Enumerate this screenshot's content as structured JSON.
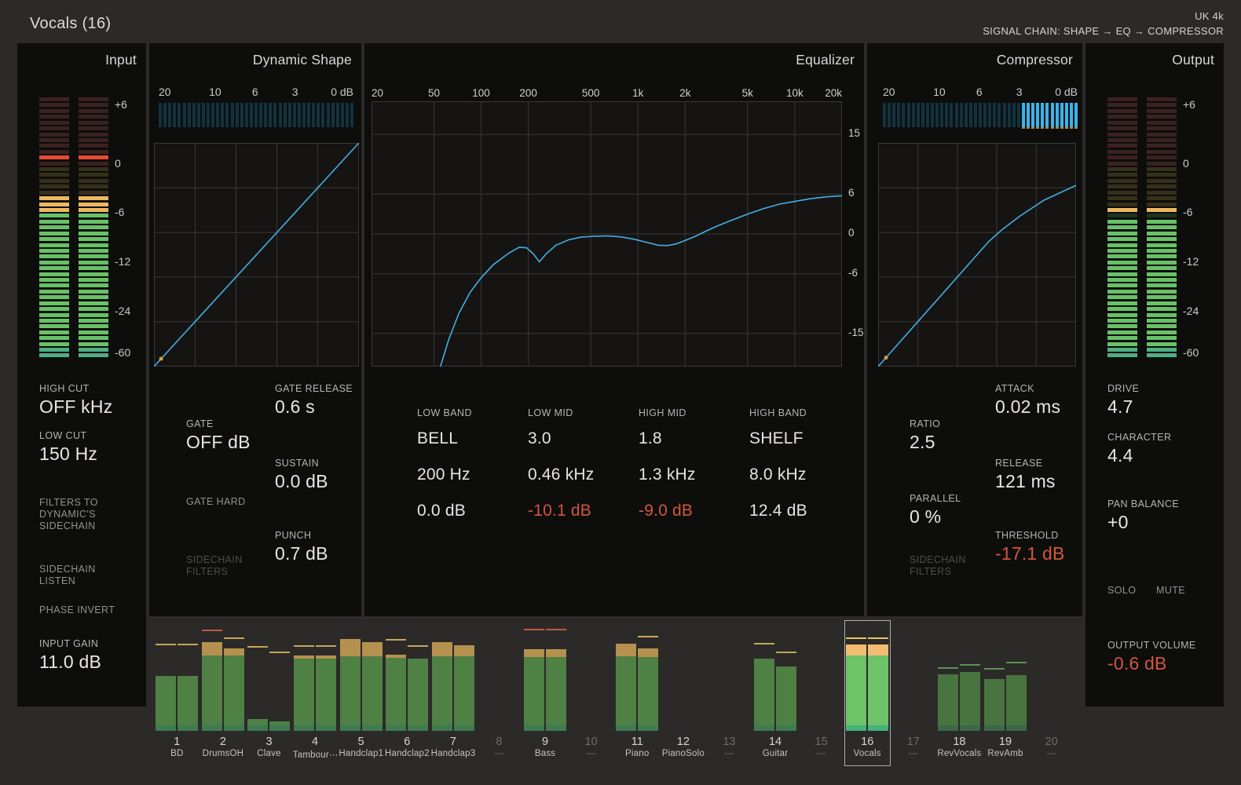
{
  "header": {
    "title": "Vocals (16)",
    "preset": "UK 4k",
    "signal_chain": "SIGNAL CHAIN: SHAPE → EQ → COMPRESSOR"
  },
  "colors": {
    "accent_blue": "#44b0e4",
    "value_red": "#d4573a",
    "gr_lit_blue": "#3cb3e9",
    "gr_unlit_teal": "#12333e",
    "gr_tick_orange": "#c08433",
    "grid": "#3a3835",
    "graph_bg": "#151413",
    "dot_orange": "#e09b3e"
  },
  "meter_zones": [
    {
      "to": 0.26,
      "unlit": "#3a2220",
      "lit": "#e84b31"
    },
    {
      "to": 0.448,
      "unlit": "#35301a",
      "lit": "#ecb95f"
    },
    {
      "to": 0.962,
      "unlit": "#1c331d",
      "lit": "#68c167"
    },
    {
      "to": 2.0,
      "unlit": "#1c331d",
      "lit": "#4fae83"
    }
  ],
  "input_panel": {
    "title": "Input",
    "scale": [
      {
        "label": "+6",
        "frac": 0.027
      },
      {
        "label": "0",
        "frac": 0.252
      },
      {
        "label": "-6",
        "frac": 0.438
      },
      {
        "label": "-12",
        "frac": 0.625
      },
      {
        "label": "-24",
        "frac": 0.814
      },
      {
        "label": "-60",
        "frac": 0.973
      }
    ],
    "meter": {
      "peak_frac": 0.222,
      "lit_from_frac": 0.385
    },
    "high_cut": {
      "label": "HIGH CUT",
      "value": "OFF kHz"
    },
    "low_cut": {
      "label": "LOW CUT",
      "value": "150 Hz"
    },
    "filters_toggle": {
      "label": "FILTERS TO DYNAMIC'S SIDECHAIN"
    },
    "sidechain_listen": {
      "label": "SIDECHAIN LISTEN"
    },
    "phase_invert": {
      "label": "PHASE INVERT"
    },
    "input_gain": {
      "label": "INPUT GAIN",
      "value": "11.0 dB"
    }
  },
  "shape_panel": {
    "title": "Dynamic Shape",
    "gr_scale": [
      "20",
      "10",
      "6",
      "3",
      "0 dB"
    ],
    "gr_lit_from_frac": 1.0,
    "curve": [
      [
        0,
        0
      ],
      [
        100,
        100
      ]
    ],
    "dot": [
      3.5,
      3.5
    ],
    "gate": {
      "label": "GATE",
      "value": "OFF dB"
    },
    "gate_release": {
      "label": "GATE RELEASE",
      "value": "0.6 s"
    },
    "sustain": {
      "label": "SUSTAIN",
      "value": "0.0 dB"
    },
    "gate_hard": {
      "label": "GATE HARD"
    },
    "punch": {
      "label": "PUNCH",
      "value": "0.7 dB"
    },
    "sidechain_filters": {
      "label": "SIDECHAIN FILTERS"
    }
  },
  "eq_panel": {
    "title": "Equalizer",
    "freq_labels": [
      "20",
      "50",
      "100",
      "200",
      "500",
      "1k",
      "2k",
      "5k",
      "10k",
      "20k"
    ],
    "freq_values": [
      20,
      50,
      100,
      200,
      500,
      1000,
      2000,
      5000,
      10000,
      20000
    ],
    "db_labels": [
      {
        "label": "15",
        "db": 15
      },
      {
        "label": "6",
        "db": 6
      },
      {
        "label": "0",
        "db": 0
      },
      {
        "label": "-6",
        "db": -6
      },
      {
        "label": "-15",
        "db": -15
      }
    ],
    "db_range": [
      -20,
      20
    ],
    "bands": [
      {
        "name": "LOW BAND",
        "q_or_type": "BELL",
        "freq": "200 Hz",
        "gain": "0.0 dB",
        "gain_red": false
      },
      {
        "name": "LOW MID",
        "q_or_type": "3.0",
        "freq": "0.46 kHz",
        "gain": "-10.1 dB",
        "gain_red": true
      },
      {
        "name": "HIGH MID",
        "q_or_type": "1.8",
        "freq": "1.3 kHz",
        "gain": "-9.0 dB",
        "gain_red": true
      },
      {
        "name": "HIGH BAND",
        "q_or_type": "SHELF",
        "freq": "8.0 kHz",
        "gain": "12.4 dB",
        "gain_red": false
      }
    ],
    "curve": [
      [
        55,
        -20
      ],
      [
        62,
        -16
      ],
      [
        72,
        -12
      ],
      [
        85,
        -8.8
      ],
      [
        100,
        -6.6
      ],
      [
        120,
        -4.6
      ],
      [
        150,
        -2.9
      ],
      [
        175,
        -2.0
      ],
      [
        195,
        -2.1
      ],
      [
        215,
        -3.0
      ],
      [
        235,
        -4.2
      ],
      [
        260,
        -3.0
      ],
      [
        300,
        -1.7
      ],
      [
        360,
        -0.9
      ],
      [
        430,
        -0.5
      ],
      [
        520,
        -0.35
      ],
      [
        640,
        -0.3
      ],
      [
        780,
        -0.45
      ],
      [
        950,
        -0.8
      ],
      [
        1150,
        -1.3
      ],
      [
        1350,
        -1.7
      ],
      [
        1550,
        -1.75
      ],
      [
        1750,
        -1.5
      ],
      [
        2000,
        -1.0
      ],
      [
        2300,
        -0.4
      ],
      [
        2700,
        0.4
      ],
      [
        3200,
        1.2
      ],
      [
        4000,
        2.1
      ],
      [
        5000,
        3.0
      ],
      [
        6300,
        3.8
      ],
      [
        8000,
        4.5
      ],
      [
        10000,
        4.9
      ],
      [
        12500,
        5.3
      ],
      [
        16000,
        5.6
      ],
      [
        20000,
        5.75
      ]
    ]
  },
  "comp_panel": {
    "title": "Compressor",
    "gr_scale": [
      "20",
      "10",
      "6",
      "3",
      "0 dB"
    ],
    "gr_lit_from_frac": 0.7,
    "curve": [
      [
        0,
        0
      ],
      [
        56,
        56
      ],
      [
        63,
        61.5
      ],
      [
        72,
        67.5
      ],
      [
        84,
        74.5
      ],
      [
        100,
        81
      ]
    ],
    "dot": [
      4,
      4
    ],
    "ratio": {
      "label": "RATIO",
      "value": "2.5"
    },
    "parallel": {
      "label": "PARALLEL",
      "value": "0 %"
    },
    "sidechain_filters": {
      "label": "SIDECHAIN FILTERS"
    },
    "attack": {
      "label": "ATTACK",
      "value": "0.02 ms"
    },
    "release": {
      "label": "RELEASE",
      "value": "121 ms"
    },
    "threshold": {
      "label": "THRESHOLD",
      "value": "-17.1 dB"
    }
  },
  "output_panel": {
    "title": "Output",
    "scale": [
      {
        "label": "+6",
        "frac": 0.027
      },
      {
        "label": "0",
        "frac": 0.252
      },
      {
        "label": "-6",
        "frac": 0.438
      },
      {
        "label": "-12",
        "frac": 0.625
      },
      {
        "label": "-24",
        "frac": 0.814
      },
      {
        "label": "-60",
        "frac": 0.973
      }
    ],
    "meter": {
      "peak_frac": 0.423,
      "lit_from_frac": 0.468
    },
    "drive": {
      "label": "DRIVE",
      "value": "4.7"
    },
    "character": {
      "label": "CHARACTER",
      "value": "4.4"
    },
    "pan_balance": {
      "label": "PAN BALANCE",
      "value": "+0"
    },
    "solo": {
      "label": "SOLO"
    },
    "mute": {
      "label": "MUTE"
    },
    "output_volume": {
      "label": "OUTPUT VOLUME",
      "value": "-0.6 dB"
    }
  },
  "mixer": {
    "palettes": {
      "active": {
        "g": "#4f8044",
        "t": "#b5914f",
        "base": "#3e7a52"
      },
      "selected": {
        "g": "#6ec368",
        "t": "#f2bc72",
        "base": "#45b27b"
      },
      "fx": {
        "g": "#48743f",
        "t": "#b5914f",
        "base": "#3c684a"
      }
    },
    "line_colors": {
      "tan": "#c9a45a",
      "red": "#c05843",
      "yellow": "#e5c565",
      "green": "#5d9152"
    },
    "channels": [
      {
        "num": "1",
        "label": "BD",
        "state": "active",
        "bars": [
          {
            "g": 0.52,
            "t": 0,
            "line": 0.81,
            "lc": "tan"
          },
          {
            "g": 0.52,
            "t": 0,
            "line": 0.81,
            "lc": "tan"
          }
        ]
      },
      {
        "num": "2",
        "label": "DrumsOH",
        "state": "active",
        "bars": [
          {
            "g": 0.72,
            "t": 0.12,
            "line": 0.95,
            "lc": "red"
          },
          {
            "g": 0.72,
            "t": 0.065,
            "line": 0.87,
            "lc": "tan"
          }
        ]
      },
      {
        "num": "3",
        "label": "Clave",
        "state": "active",
        "bars": [
          {
            "g": 0.115,
            "t": 0,
            "line": 0.79,
            "lc": "tan"
          },
          {
            "g": 0.09,
            "t": 0,
            "line": 0.74,
            "lc": "tan"
          }
        ]
      },
      {
        "num": "4",
        "label": "Tambour⋯",
        "state": "active",
        "bars": [
          {
            "g": 0.69,
            "t": 0.03,
            "line": 0.8,
            "lc": "tan"
          },
          {
            "g": 0.69,
            "t": 0.03,
            "line": 0.8,
            "lc": "tan"
          }
        ]
      },
      {
        "num": "5",
        "label": "Handclap1",
        "state": "active",
        "bars": [
          {
            "g": 0.71,
            "t": 0.165,
            "line": null
          },
          {
            "g": 0.71,
            "t": 0.135,
            "line": null
          }
        ]
      },
      {
        "num": "6",
        "label": "Handclap2",
        "state": "active",
        "bars": [
          {
            "g": 0.695,
            "t": 0.03,
            "line": 0.86,
            "lc": "tan"
          },
          {
            "g": 0.685,
            "t": 0,
            "line": 0.8,
            "lc": "tan"
          }
        ]
      },
      {
        "num": "7",
        "label": "Handclap3",
        "state": "active",
        "bars": [
          {
            "g": 0.71,
            "t": 0.135,
            "line": null
          },
          {
            "g": 0.71,
            "t": 0.105,
            "line": null
          }
        ]
      },
      {
        "num": "8",
        "label": "—",
        "state": "empty",
        "bars": []
      },
      {
        "num": "9",
        "label": "Bass",
        "state": "active",
        "bars": [
          {
            "g": 0.7,
            "t": 0.075,
            "line": 0.955,
            "lc": "red"
          },
          {
            "g": 0.7,
            "t": 0.075,
            "line": 0.955,
            "lc": "red"
          }
        ]
      },
      {
        "num": "10",
        "label": "—",
        "state": "empty",
        "bars": []
      },
      {
        "num": "11",
        "label": "Piano",
        "state": "active",
        "bars": [
          {
            "g": 0.71,
            "t": 0.12,
            "line": null
          },
          {
            "g": 0.705,
            "t": 0.075,
            "line": 0.89,
            "lc": "tan"
          }
        ]
      },
      {
        "num": "12",
        "label": "PianoSolo",
        "state": "active",
        "bars": []
      },
      {
        "num": "13",
        "label": "—",
        "state": "empty",
        "bars": []
      },
      {
        "num": "14",
        "label": "Guitar",
        "state": "active",
        "bars": [
          {
            "g": 0.69,
            "t": 0,
            "line": 0.82,
            "lc": "tan"
          },
          {
            "g": 0.615,
            "t": 0,
            "line": 0.74,
            "lc": "tan"
          }
        ]
      },
      {
        "num": "15",
        "label": "—",
        "state": "empty",
        "bars": []
      },
      {
        "num": "16",
        "label": "Vocals",
        "state": "selected",
        "bars": [
          {
            "g": 0.72,
            "t": 0.1,
            "line": 0.875,
            "lc": "yellow"
          },
          {
            "g": 0.72,
            "t": 0.1,
            "line": 0.875,
            "lc": "yellow"
          }
        ]
      },
      {
        "num": "17",
        "label": "—",
        "state": "empty",
        "bars": []
      },
      {
        "num": "18",
        "label": "RevVocals",
        "state": "fx",
        "bars": [
          {
            "g": 0.54,
            "t": 0,
            "line": 0.59,
            "lc": "green"
          },
          {
            "g": 0.56,
            "t": 0,
            "line": 0.62,
            "lc": "green"
          }
        ]
      },
      {
        "num": "19",
        "label": "RevAmb",
        "state": "fx",
        "bars": [
          {
            "g": 0.495,
            "t": 0,
            "line": 0.58,
            "lc": "green"
          },
          {
            "g": 0.53,
            "t": 0,
            "line": 0.645,
            "lc": "green"
          }
        ]
      },
      {
        "num": "20",
        "label": "—",
        "state": "empty",
        "bars": []
      }
    ]
  }
}
